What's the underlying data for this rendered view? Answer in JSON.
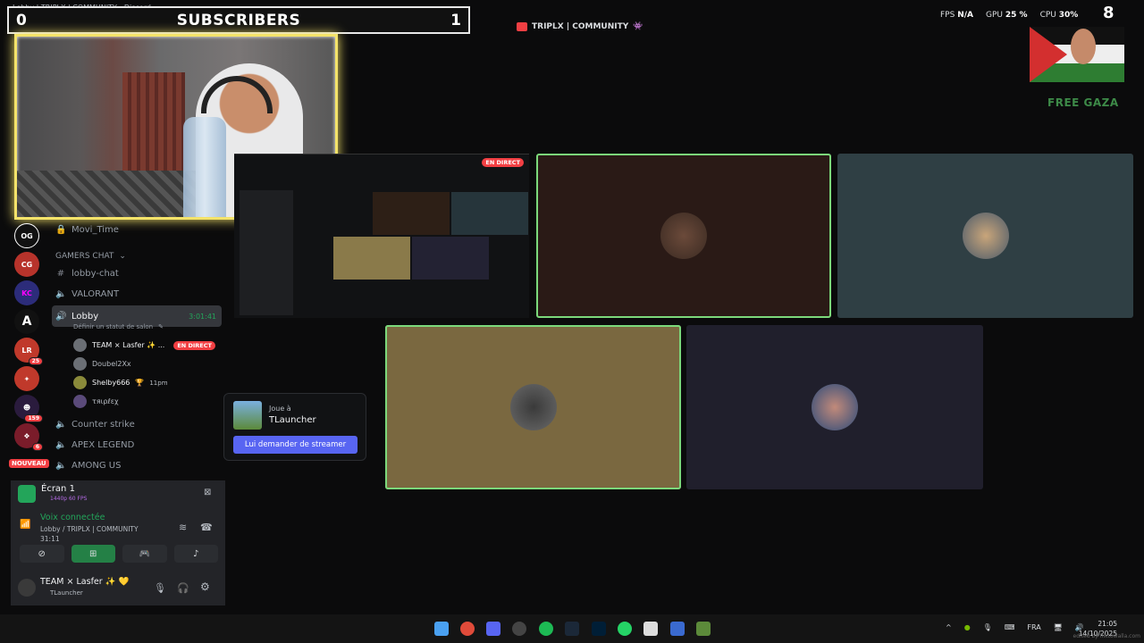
{
  "window": {
    "title": "Lobby | TRIPLX | COMMUNITY - Discord"
  },
  "subscribers": {
    "left_count": "0",
    "title": "SUBSCRIBERS",
    "right_count": "1"
  },
  "overlay": {
    "community": "TRIPLX | COMMUNITY",
    "stats": {
      "fps_label": "FPS",
      "fps_value": "N/A",
      "gpu_label": "GPU",
      "gpu_value": "25 %",
      "cpu_label": "CPU",
      "cpu_value": "30%"
    },
    "free_gaza": "FREE GAZA",
    "corner_number": "8"
  },
  "servers": [
    {
      "name": "server-1",
      "badge": ""
    },
    {
      "name": "server-2",
      "badge": ""
    },
    {
      "name": "server-3",
      "badge": ""
    },
    {
      "name": "server-4",
      "badge": ""
    },
    {
      "name": "server-5",
      "badge": "25"
    },
    {
      "name": "server-6",
      "badge": ""
    },
    {
      "name": "server-7",
      "badge": "159"
    },
    {
      "name": "server-8",
      "badge": "6"
    }
  ],
  "nouveau_label": "NOUVEAU",
  "channels": {
    "movi_time": "Movi_Time",
    "category": "GAMERS CHAT",
    "lobby_chat": "lobby-chat",
    "valorant": "VALORANT",
    "lobby": "Lobby",
    "lobby_time": "3:01:41",
    "lobby_status": "Définir un statut de salon",
    "counter_strike": "Counter strike",
    "apex": "APEX LEGEND",
    "among_us": "AMONG US"
  },
  "members": [
    {
      "name": "TEAM × Lasfer ✨ ...",
      "live": "EN DIRECT"
    },
    {
      "name": "Doubel2Xx",
      "live": ""
    },
    {
      "name": "Shelby666",
      "live": "",
      "extra": "11pm"
    },
    {
      "name": "τяιρℓεχ",
      "live": ""
    }
  ],
  "panel": {
    "screen_title": "Écran 1",
    "screen_sub": "1440p 60 FPS",
    "voice_status": "Voix connectée",
    "voice_channel": "Lobby / TRIPLX | COMMUNITY",
    "voice_time": "31:11",
    "user_name": "TEAM × Lasfer ✨ 💛",
    "user_status": "TLauncher"
  },
  "popup": {
    "label": "Joue à",
    "game": "TLauncher",
    "button": "Lui demander de streamer"
  },
  "stream": {
    "live": "EN DIRECT"
  },
  "taskbar": {
    "lang": "FRA",
    "time": "21:05",
    "date": "14/10/2025",
    "watermark": "edited by fliktowalla.com"
  },
  "colors": {
    "accent": "#5865f2",
    "live": "#f23f43",
    "online": "#23a55a",
    "speaking": "#7cd97b"
  }
}
